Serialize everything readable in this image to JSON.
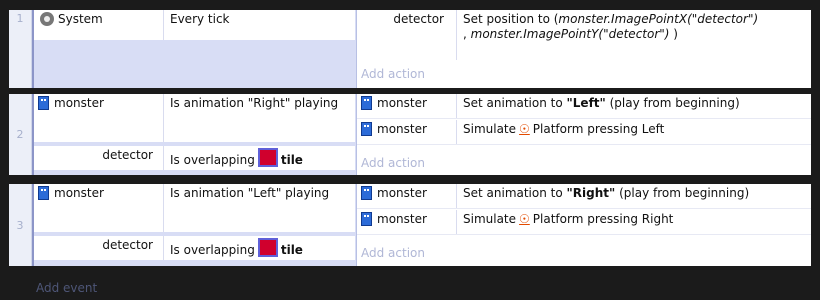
{
  "events": [
    {
      "number": "1",
      "conditions": [
        {
          "object": "System",
          "icon": "gear-icon",
          "text": "Every tick"
        }
      ],
      "actions": [
        {
          "object": "detector",
          "text_prefix": "Set position to (",
          "text_emph": "monster.ImagePointX(\"detector\")",
          "text_mid": ", ",
          "text_emph2": "monster.ImagePointY(\"detector\")",
          "text_suffix": " )"
        }
      ],
      "add_action": "Add action"
    },
    {
      "number": "2",
      "conditions": [
        {
          "object": "monster",
          "icon": "sprite-icon",
          "text": "Is animation \"Right\" playing"
        },
        {
          "object": "detector",
          "text": "Is overlapping",
          "target": "tile"
        }
      ],
      "actions": [
        {
          "object": "monster",
          "icon": "sprite-icon",
          "text_prefix": "Set animation to ",
          "text_bold": "\"Left\"",
          "text_suffix": " (play from beginning)"
        },
        {
          "object": "monster",
          "icon": "sprite-icon",
          "text_prefix": "Simulate",
          "behavior": "Platform",
          "text_suffix": "pressing Left"
        }
      ],
      "add_action": "Add action"
    },
    {
      "number": "3",
      "conditions": [
        {
          "object": "monster",
          "icon": "sprite-icon",
          "text": "Is animation \"Left\" playing"
        },
        {
          "object": "detector",
          "text": "Is overlapping",
          "target": "tile"
        }
      ],
      "actions": [
        {
          "object": "monster",
          "icon": "sprite-icon",
          "text_prefix": "Set animation to ",
          "text_bold": "\"Right\"",
          "text_suffix": " (play from beginning)"
        },
        {
          "object": "monster",
          "icon": "sprite-icon",
          "text_prefix": "Simulate",
          "behavior": "Platform",
          "text_suffix": "pressing Right"
        }
      ],
      "add_action": "Add action"
    }
  ],
  "add_event": "Add event",
  "colors": {
    "background": "#1b1b1b",
    "condition_area": "#d8ddf5",
    "tile_swatch": "#d0002d",
    "muted": "#b0b7d6"
  }
}
